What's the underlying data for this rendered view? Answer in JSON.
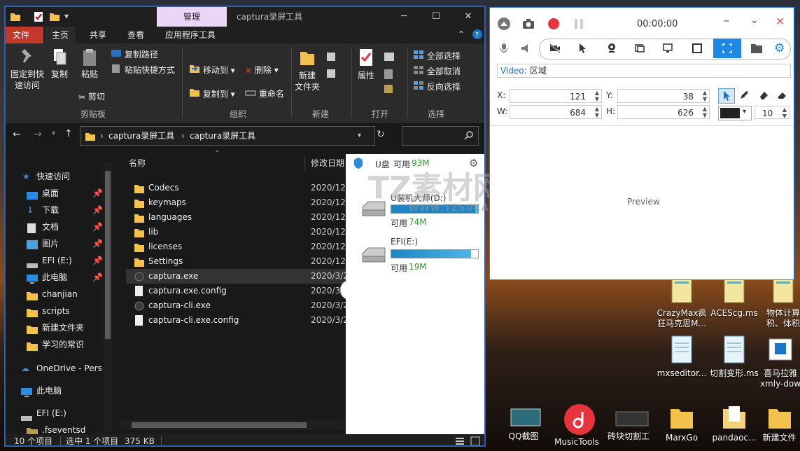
{
  "explorer": {
    "title": "captura录屏工具",
    "context_tab": "管理",
    "ribbon_tabs": [
      "文件",
      "主页",
      "共享",
      "查看",
      "应用程序工具"
    ],
    "clipboard": {
      "pin": "固定到快\n速访问",
      "copy": "复制",
      "paste": "粘贴",
      "copy_path": "复制路径",
      "paste_shortcut": "粘贴快捷方式",
      "cut": "剪切",
      "label": "剪贴板"
    },
    "organize": {
      "move_to": "移动到",
      "copy_to": "复制到",
      "delete": "删除",
      "rename": "重命名",
      "label": "组织"
    },
    "new": {
      "new_folder": "新建\n文件夹",
      "label": "新建"
    },
    "open": {
      "properties": "属性",
      "label": "打开"
    },
    "select": {
      "select_all": "全部选择",
      "select_none": "全部取消",
      "invert": "反向选择",
      "label": "选择"
    },
    "address": {
      "part1": "captura录屏工具",
      "part2": "captura录屏工具"
    },
    "nav": [
      {
        "label": "快速访问",
        "icon": "star-icon"
      },
      {
        "label": "桌面",
        "icon": "desktop-icon"
      },
      {
        "label": "下载",
        "icon": "download-icon"
      },
      {
        "label": "文档",
        "icon": "document-icon"
      },
      {
        "label": "图片",
        "icon": "picture-icon"
      },
      {
        "label": "EFI (E:)",
        "icon": "drive-icon"
      },
      {
        "label": "此电脑",
        "icon": "computer-icon"
      },
      {
        "label": "chanjian",
        "icon": "folder-icon"
      },
      {
        "label": "scripts",
        "icon": "folder-icon"
      },
      {
        "label": "新建文件夹",
        "icon": "folder-icon"
      },
      {
        "label": "学习的常识",
        "icon": "folder-icon"
      },
      {
        "label": "OneDrive - Pers",
        "icon": "cloud-icon"
      },
      {
        "label": "此电脑",
        "icon": "computer-icon"
      },
      {
        "label": "EFI (E:)",
        "icon": "drive-icon"
      },
      {
        "label": ".fseventsd",
        "icon": "folder-icon"
      }
    ],
    "columns": {
      "name": "名称",
      "date": "修改日期"
    },
    "files": [
      {
        "name": "Codecs",
        "date": "2020/12/",
        "type": "folder"
      },
      {
        "name": "keymaps",
        "date": "2020/12/",
        "type": "folder"
      },
      {
        "name": "languages",
        "date": "2020/12/",
        "type": "folder"
      },
      {
        "name": "lib",
        "date": "2020/12/",
        "type": "folder"
      },
      {
        "name": "licenses",
        "date": "2020/12/",
        "type": "folder"
      },
      {
        "name": "Settings",
        "date": "2020/12/",
        "type": "folder"
      },
      {
        "name": "captura.exe",
        "date": "2020/3/2",
        "type": "exe"
      },
      {
        "name": "captura.exe.config",
        "date": "2020/3/2",
        "type": "file"
      },
      {
        "name": "captura-cli.exe",
        "date": "2020/3/2",
        "type": "exe"
      },
      {
        "name": "captura-cli.exe.config",
        "date": "2020/3/2",
        "type": "file"
      }
    ],
    "status": {
      "count": "10 个项目",
      "selected": "选中 1 个项目",
      "size": "375 KB"
    }
  },
  "usb": {
    "title": "U盘",
    "available_label": "可用",
    "available_value": "93M",
    "drives": [
      {
        "name": "U装机大师(D:)",
        "free_label": "可用",
        "free": "74M",
        "fill": 0.97
      },
      {
        "name": "EFI(E:)",
        "free_label": "可用",
        "free": "19M",
        "fill": 0.92
      }
    ]
  },
  "watermark": {
    "big": "TZ素材网",
    "small": "WWW.TZSUCAI.COM"
  },
  "captura": {
    "timer": "00:00:00",
    "video_label": "Video:",
    "video_value": "区域",
    "x_label": "X:",
    "x": "121",
    "y_label": "Y:",
    "y": "38",
    "w_label": "W:",
    "w": "684",
    "h_label": "H:",
    "h": "626",
    "stroke": "10",
    "preview": "Preview"
  },
  "desktop": [
    {
      "label": "CrazyMax疯\n狂马克思M...",
      "icon": "document-icon"
    },
    {
      "label": "ACEScg.ms",
      "icon": "document-icon"
    },
    {
      "label": "物体计算\n积、体积",
      "icon": "document-icon"
    },
    {
      "label": "mxseditor...",
      "icon": "notepad-icon"
    },
    {
      "label": "切割变形.ms",
      "icon": "notepad-icon"
    },
    {
      "label": "喜马拉雅\nxmly-dow",
      "icon": "app-icon"
    },
    {
      "label": "QQ截图",
      "icon": "image-icon"
    },
    {
      "label": "MusicTools",
      "icon": "music-icon"
    },
    {
      "label": "砖块切割工",
      "icon": "app-icon"
    },
    {
      "label": "MarxGo",
      "icon": "folder-icon"
    },
    {
      "label": "pandaoc...",
      "icon": "folder-icon"
    },
    {
      "label": "新建文件",
      "icon": "folder-icon"
    }
  ]
}
